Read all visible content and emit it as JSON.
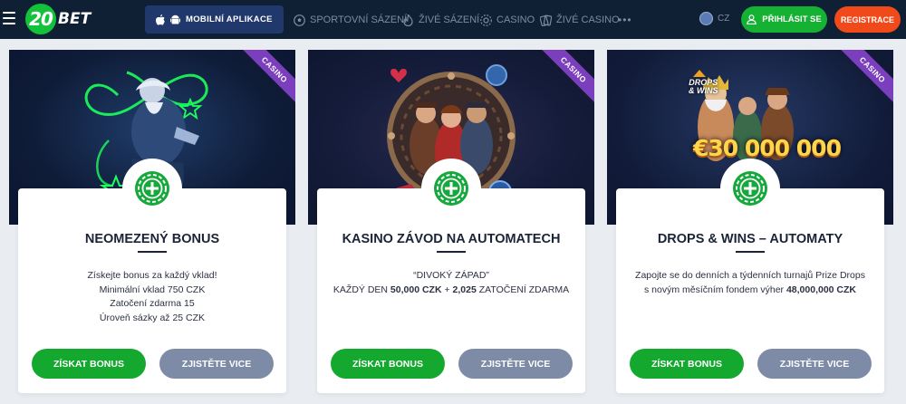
{
  "header": {
    "logo_text": "BET",
    "logo_number": "20",
    "app_button": "MOBILNÍ APLIKACE",
    "nav": [
      {
        "label": "SPORTOVNÍ SÁZENÍ",
        "icon": "soccer-ball-icon"
      },
      {
        "label": "ŽIVÉ SÁZENÍ",
        "icon": "live-fire-icon"
      },
      {
        "label": "CASINO",
        "icon": "casino-chip-icon"
      },
      {
        "label": "ŽIVÉ CASINO",
        "icon": "cards-icon"
      }
    ],
    "more": "•••",
    "lang": "CZ",
    "login": "PŘIHLÁSIT SE",
    "register": "REGISTRACE"
  },
  "cards": [
    {
      "ribbon": "CASINO",
      "title": "NEOMEZENÝ BONUS",
      "lines": [
        "Získejte bonus za každý vklad!",
        "Minimální vklad 750 CZK",
        "Zatočení zdarma 15",
        "Úroveň sázky až 25 CZK"
      ],
      "primary": "ZÍSKAT BONUS",
      "secondary": "ZJISTĚTE VICE"
    },
    {
      "ribbon": "CASINO",
      "title": "KASINO ZÁVOD NA AUTOMATECH",
      "line1": "“DIVOKÝ ZÁPAD”",
      "line2_pre": "KAŽDÝ DEN ",
      "line2_b1": "50,000 CZK",
      "line2_mid": " + ",
      "line2_b2": "2,025",
      "line2_post": " ZATOČENÍ ZDARMA",
      "primary": "ZÍSKAT BONUS",
      "secondary": "ZJISTĚTE VICE"
    },
    {
      "ribbon": "CASINO",
      "title": "DROPS & WINS – AUTOMATY",
      "line1": "Zapojte se do denních a týdenních turnajů Prize Drops",
      "line2_pre": "s novým měsíčním fondem výher ",
      "line2_b": "48,000,000 CZK",
      "promo_logo_1": "DROPS",
      "promo_logo_2": "& WINS",
      "promo_amount": "€30 000 000",
      "primary": "ZÍSKAT BONUS",
      "secondary": "ZJISTĚTE VICE"
    }
  ]
}
